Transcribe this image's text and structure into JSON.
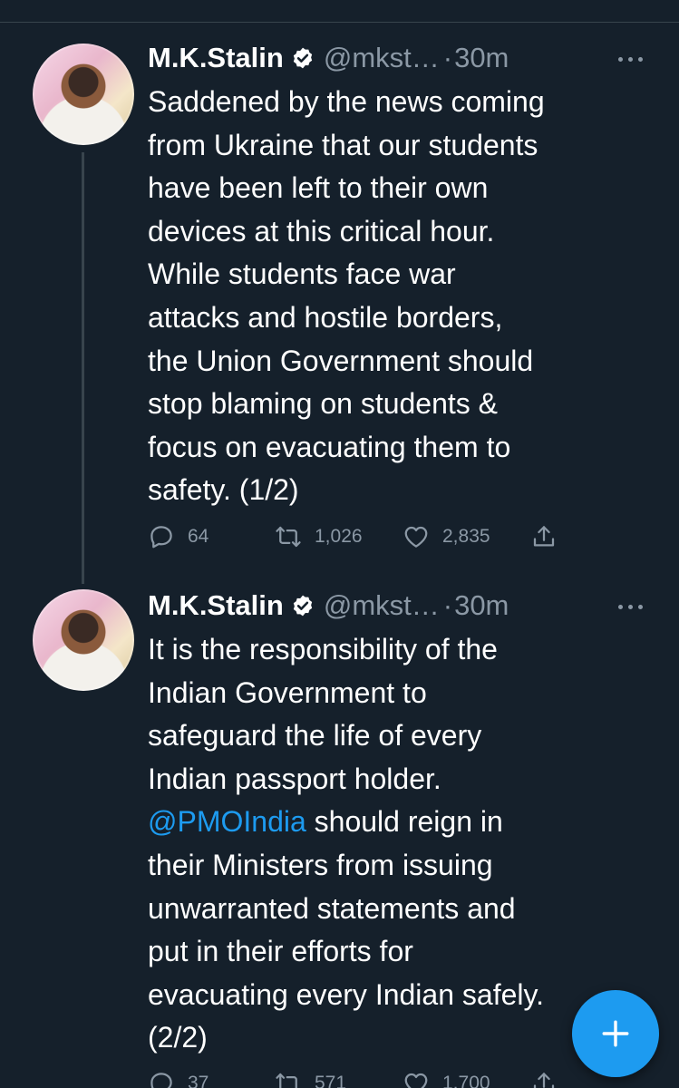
{
  "colors": {
    "background": "#15202b",
    "divider": "#38444d",
    "secondary_text": "#8b98a5",
    "accent": "#1d9bf0"
  },
  "tweets": [
    {
      "author_name": "M.K.Stalin",
      "handle": "@mkst…",
      "separator": "·",
      "time": "30m",
      "avatar_icon": "profile-photo",
      "lines": [
        "Saddened by the news coming",
        "from Ukraine that our students",
        "have been left to their own",
        "devices at this critical hour.",
        "While students face war",
        "attacks and hostile borders,",
        "the Union Government should",
        "stop blaming on students &",
        "focus on evacuating them to",
        "safety. (1/2)"
      ],
      "replies": "64",
      "retweets": "1,026",
      "likes": "2,835"
    },
    {
      "author_name": "M.K.Stalin",
      "handle": "@mkst…",
      "separator": "·",
      "time": "30m",
      "avatar_icon": "profile-photo",
      "lines": [
        "It is the responsibility of the",
        "Indian Government to",
        "safeguard the life of every",
        "Indian passport holder.",
        "should reign in",
        "their Ministers from issuing",
        "unwarranted statements and",
        "put in their efforts for",
        "evacuating every Indian safely.",
        "(2/2)"
      ],
      "mention": "@PMOIndia",
      "replies": "37",
      "retweets": "571",
      "likes": "1,700"
    }
  ],
  "fab": {
    "icon": "plus-icon",
    "label": "+"
  }
}
